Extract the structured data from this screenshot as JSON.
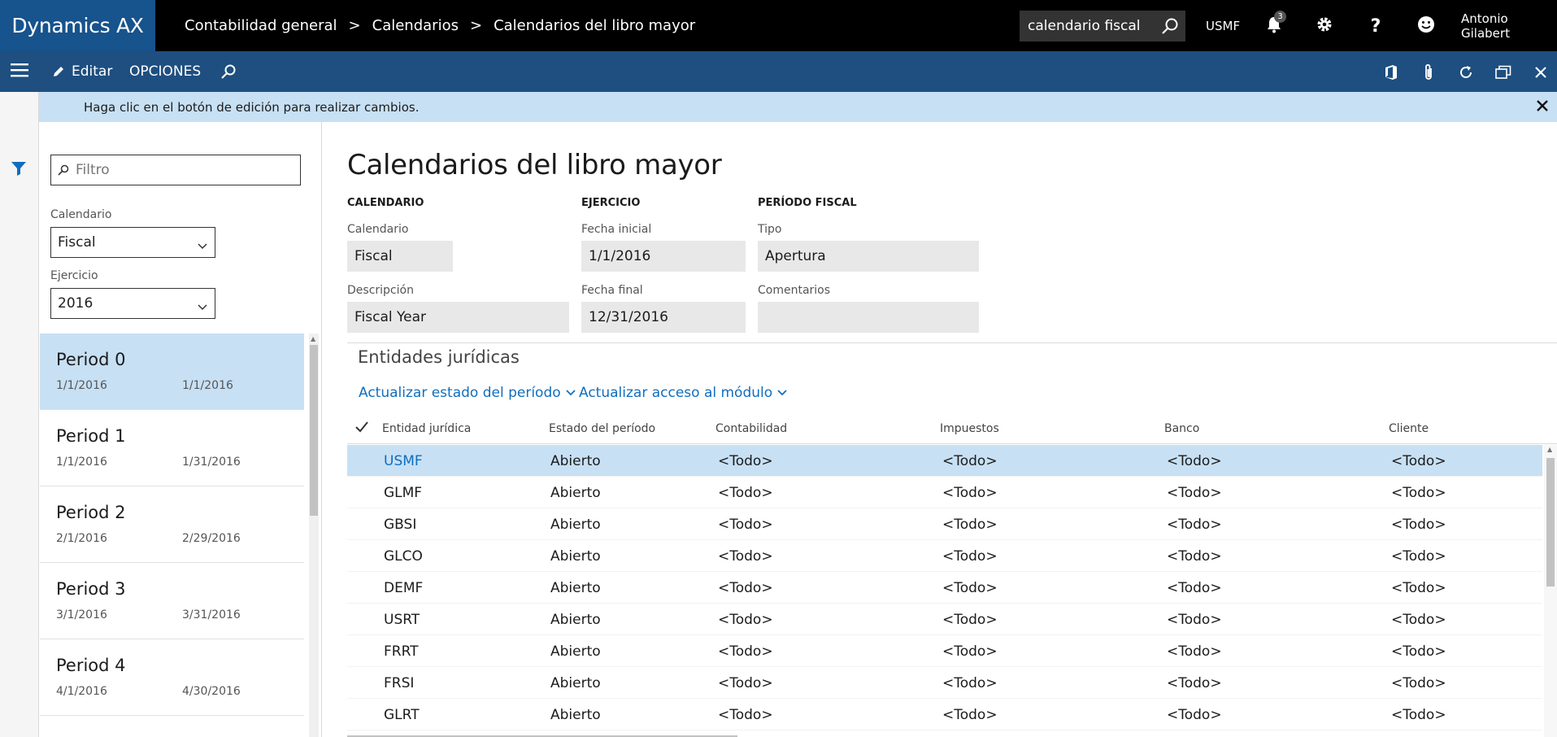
{
  "header": {
    "app_name": "Dynamics AX",
    "breadcrumb": [
      "Contabilidad general",
      "Calendarios",
      "Calendarios del libro mayor"
    ],
    "breadcrumb_sep": ">",
    "search_value": "calendario fiscal",
    "company": "USMF",
    "notification_count": "3",
    "user_name": "Antonio Gilabert"
  },
  "actionbar": {
    "edit_label": "Editar",
    "options_label": "OPCIONES"
  },
  "message": {
    "text": "Haga clic en el botón de edición para realizar cambios."
  },
  "listpanel": {
    "filter_placeholder": "Filtro",
    "calendar_label": "Calendario",
    "calendar_value": "Fiscal",
    "year_label": "Ejercicio",
    "year_value": "2016",
    "periods": [
      {
        "name": "Period 0",
        "start": "1/1/2016",
        "end": "1/1/2016"
      },
      {
        "name": "Period 1",
        "start": "1/1/2016",
        "end": "1/31/2016"
      },
      {
        "name": "Period 2",
        "start": "2/1/2016",
        "end": "2/29/2016"
      },
      {
        "name": "Period 3",
        "start": "3/1/2016",
        "end": "3/31/2016"
      },
      {
        "name": "Period 4",
        "start": "4/1/2016",
        "end": "4/30/2016"
      }
    ]
  },
  "detail": {
    "title": "Calendarios del libro mayor",
    "groups": {
      "calendar": "CALENDARIO",
      "year": "EJERCICIO",
      "period": "PERÍODO FISCAL"
    },
    "fields": {
      "calendar_label": "Calendario",
      "calendar_value": "Fiscal",
      "description_label": "Descripción",
      "description_value": "Fiscal Year",
      "start_label": "Fecha inicial",
      "start_value": "1/1/2016",
      "end_label": "Fecha final",
      "end_value": "12/31/2016",
      "type_label": "Tipo",
      "type_value": "Apertura",
      "comments_label": "Comentarios",
      "comments_value": ""
    },
    "section_title": "Entidades jurídicas",
    "update_period_status": "Actualizar estado del período",
    "update_module_access": "Actualizar acceso al módulo",
    "grid": {
      "columns": [
        "Entidad jurídica",
        "Estado del período",
        "Contabilidad",
        "Impuestos",
        "Banco",
        "Cliente"
      ],
      "rows": [
        [
          "USMF",
          "Abierto",
          "<Todo>",
          "<Todo>",
          "<Todo>",
          "<Todo>"
        ],
        [
          "GLMF",
          "Abierto",
          "<Todo>",
          "<Todo>",
          "<Todo>",
          "<Todo>"
        ],
        [
          "GBSI",
          "Abierto",
          "<Todo>",
          "<Todo>",
          "<Todo>",
          "<Todo>"
        ],
        [
          "GLCO",
          "Abierto",
          "<Todo>",
          "<Todo>",
          "<Todo>",
          "<Todo>"
        ],
        [
          "DEMF",
          "Abierto",
          "<Todo>",
          "<Todo>",
          "<Todo>",
          "<Todo>"
        ],
        [
          "USRT",
          "Abierto",
          "<Todo>",
          "<Todo>",
          "<Todo>",
          "<Todo>"
        ],
        [
          "FRRT",
          "Abierto",
          "<Todo>",
          "<Todo>",
          "<Todo>",
          "<Todo>"
        ],
        [
          "FRSI",
          "Abierto",
          "<Todo>",
          "<Todo>",
          "<Todo>",
          "<Todo>"
        ],
        [
          "GLRT",
          "Abierto",
          "<Todo>",
          "<Todo>",
          "<Todo>",
          "<Todo>"
        ]
      ]
    }
  },
  "colors": {
    "brand": "#17538c",
    "actionbar": "#1e4f80",
    "selection": "#c7e0f4",
    "link": "#106ebe"
  }
}
